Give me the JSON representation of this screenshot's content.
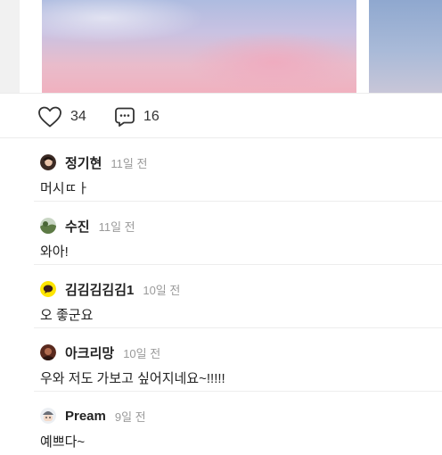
{
  "post": {
    "like_count": "34",
    "comment_count": "16"
  },
  "comments": [
    {
      "name": "정기현",
      "time": "11일 전",
      "text": "머시ㄸㅏ",
      "avatar": "woman-portrait"
    },
    {
      "name": "수진",
      "time": "11일 전",
      "text": "와아!",
      "avatar": "landscape-photo"
    },
    {
      "name": "김김김김김1",
      "time": "10일 전",
      "text": "오 좋군요",
      "avatar": "kakao-talk-bubble"
    },
    {
      "name": "아크리망",
      "time": "10일 전",
      "text": "우와 저도 가보고 싶어지네요~!!!!!",
      "avatar": "dark-portrait"
    },
    {
      "name": "Pream",
      "time": "9일 전",
      "text": "예쁘다~",
      "avatar": "character-face"
    }
  ],
  "colors": {
    "muted": "#9a9a9a",
    "kakao_yellow": "#FEE500"
  }
}
